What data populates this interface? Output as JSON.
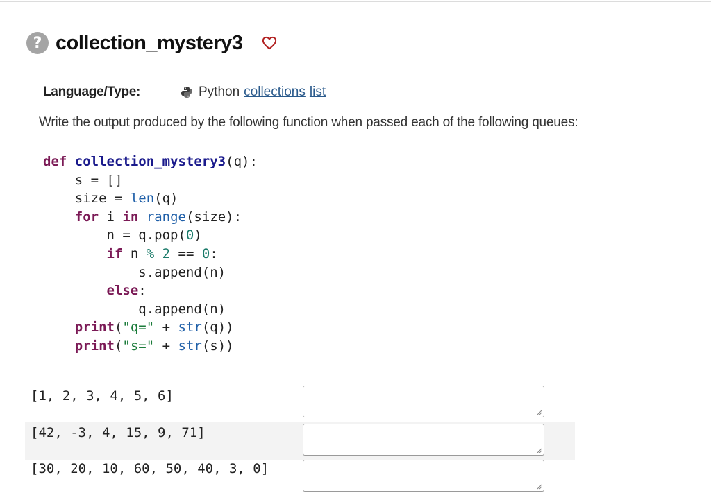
{
  "problem": {
    "help_icon": "help-circle-icon",
    "title": "collection_mystery3",
    "favorite_icon": "heart-outline-icon",
    "language_label": "Language/Type:",
    "language_icon": "python-icon",
    "language": "Python",
    "tags": [
      "collections",
      "list"
    ],
    "prompt": "Write the output produced by the following function when passed each of the following queues:"
  },
  "code": {
    "lines": [
      "def collection_mystery3(q):",
      "    s = []",
      "    size = len(q)",
      "    for i in range(size):",
      "        n = q.pop(0)",
      "        if n % 2 == 0:",
      "            s.append(n)",
      "        else:",
      "            q.append(n)",
      "    print(\"q=\" + str(q))",
      "    print(\"s=\" + str(s))"
    ]
  },
  "questions": [
    {
      "input": "[1, 2, 3, 4, 5, 6]",
      "answer": ""
    },
    {
      "input": "[42, -3, 4, 15, 9, 71]",
      "answer": ""
    },
    {
      "input": "[30, 20, 10, 60, 50, 40, 3, 0]",
      "answer": ""
    }
  ],
  "colors": {
    "keyword": "#7b1a56",
    "builtin": "#1f5fa8",
    "string": "#1b7b3a",
    "link": "#2a5a8c",
    "heart": "#b22222"
  }
}
